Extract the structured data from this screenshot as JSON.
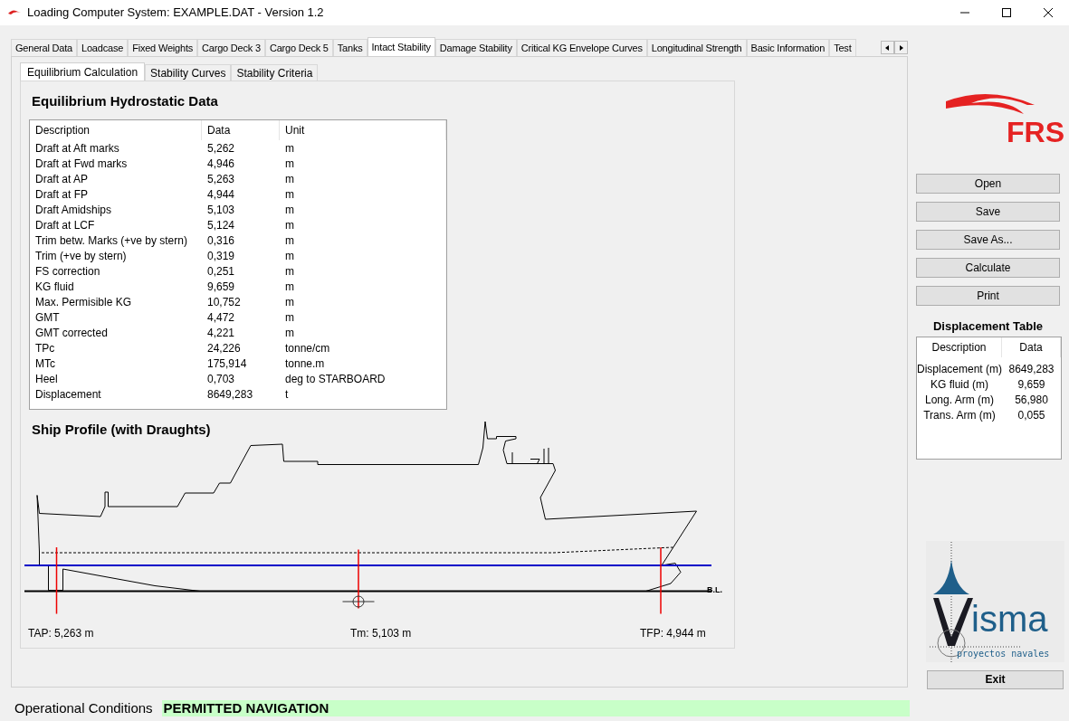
{
  "window": {
    "title": "Loading Computer System: EXAMPLE.DAT - Version 1.2"
  },
  "main_tabs": [
    {
      "label": "General Data",
      "selected": false
    },
    {
      "label": "Loadcase",
      "selected": false
    },
    {
      "label": "Fixed Weights",
      "selected": false
    },
    {
      "label": "Cargo Deck 3",
      "selected": false
    },
    {
      "label": "Cargo Deck 5",
      "selected": false
    },
    {
      "label": "Tanks",
      "selected": false
    },
    {
      "label": "Intact Stability",
      "selected": true
    },
    {
      "label": "Damage Stability",
      "selected": false
    },
    {
      "label": "Critical KG Envelope Curves",
      "selected": false
    },
    {
      "label": "Longitudinal Strength",
      "selected": false
    },
    {
      "label": "Basic Information",
      "selected": false
    },
    {
      "label": "Test",
      "selected": false
    }
  ],
  "sub_tabs": [
    {
      "label": "Equilibrium Calculation",
      "selected": true
    },
    {
      "label": "Stability Curves",
      "selected": false
    },
    {
      "label": "Stability Criteria",
      "selected": false
    }
  ],
  "hydrostatic": {
    "title": "Equilibrium Hydrostatic Data",
    "columns": [
      "Description",
      "Data",
      "Unit"
    ],
    "rows": [
      {
        "description": "Draft at Aft marks",
        "data": "5,262",
        "unit": "m"
      },
      {
        "description": "Draft at Fwd marks",
        "data": "4,946",
        "unit": "m"
      },
      {
        "description": "Draft at AP",
        "data": "5,263",
        "unit": "m"
      },
      {
        "description": "Draft at FP",
        "data": "4,944",
        "unit": "m"
      },
      {
        "description": "Draft Amidships",
        "data": "5,103",
        "unit": "m"
      },
      {
        "description": "Draft at LCF",
        "data": "5,124",
        "unit": "m"
      },
      {
        "description": "Trim betw. Marks (+ve by stern)",
        "data": "0,316",
        "unit": "m"
      },
      {
        "description": "Trim (+ve by stern)",
        "data": "0,319",
        "unit": "m"
      },
      {
        "description": "FS correction",
        "data": "0,251",
        "unit": "m"
      },
      {
        "description": "KG fluid",
        "data": "9,659",
        "unit": "m"
      },
      {
        "description": "Max. Permisible KG",
        "data": "10,752",
        "unit": "m"
      },
      {
        "description": "GMT",
        "data": "4,472",
        "unit": "m"
      },
      {
        "description": "GMT corrected",
        "data": "4,221",
        "unit": "m"
      },
      {
        "description": "TPc",
        "data": "24,226",
        "unit": "tonne/cm"
      },
      {
        "description": "MTc",
        "data": "175,914",
        "unit": "tonne.m"
      },
      {
        "description": "Heel",
        "data": "0,703",
        "unit": "deg to STARBOARD"
      },
      {
        "description": "Displacement",
        "data": "8649,283",
        "unit": "t"
      }
    ]
  },
  "profile": {
    "title": "Ship Profile (with Draughts)",
    "baseline_label": "B.L.",
    "marks": [
      "TAP: 5,263 m",
      "Tm: 5,103 m",
      "TFP: 4,944 m"
    ]
  },
  "top_logo": {
    "text": "FRS"
  },
  "buttons": [
    "Open",
    "Save",
    "Save As...",
    "Calculate",
    "Print"
  ],
  "displacement_table": {
    "title": "Displacement Table",
    "columns": [
      "Description",
      "Data"
    ],
    "rows": [
      {
        "description": "Displacement (m)",
        "data": "8649,283"
      },
      {
        "description": "KG fluid (m)",
        "data": "9,659"
      },
      {
        "description": "Long. Arm (m)",
        "data": "56,980"
      },
      {
        "description": "Trans. Arm (m)",
        "data": "0,055"
      }
    ]
  },
  "bottom_logo": {
    "text": "isma",
    "tagline": "proyectos navales"
  },
  "exit_button": "Exit",
  "status": {
    "label": "Operational Conditions",
    "value": "PERMITTED NAVIGATION"
  }
}
